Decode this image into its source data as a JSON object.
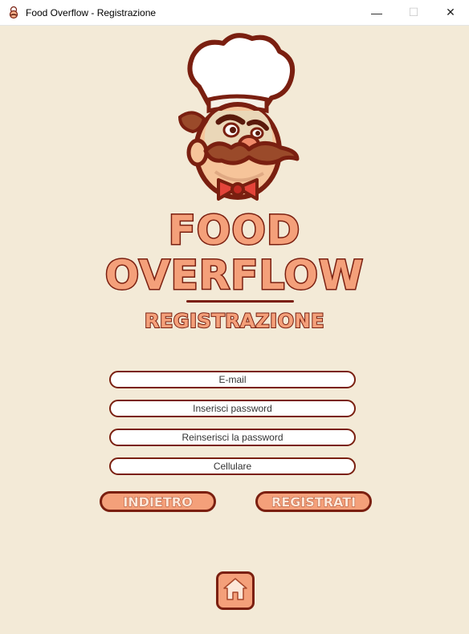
{
  "window": {
    "title": "Food Overflow - Registrazione",
    "controls": {
      "minimize": "—",
      "maximize": "☐",
      "close": "✕"
    }
  },
  "logo": {
    "line1": "FOOD",
    "line2": "OVERFLOW",
    "subtitle": "REGISTRAZIONE"
  },
  "form": {
    "email_placeholder": "E-mail",
    "password_placeholder": "Inserisci password",
    "password_confirm_placeholder": "Reinserisci la password",
    "phone_placeholder": "Cellulare"
  },
  "buttons": {
    "back_label": "INDIETRO",
    "register_label": "REGISTRATI",
    "home_icon": "home-icon"
  },
  "colors": {
    "background": "#f3ead7",
    "accent": "#f4a07a",
    "outline": "#7a1f10"
  }
}
